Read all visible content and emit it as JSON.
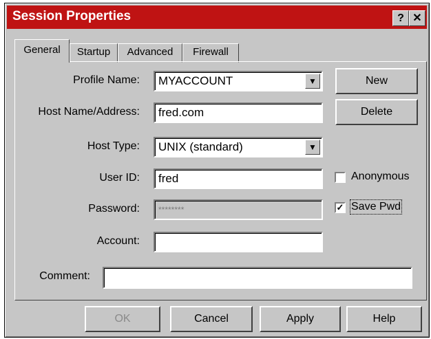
{
  "window": {
    "title": "Session Properties",
    "help_button": "?",
    "close_button": "✕"
  },
  "tabs": [
    {
      "label": "General",
      "active": true
    },
    {
      "label": "Startup",
      "active": false
    },
    {
      "label": "Advanced",
      "active": false
    },
    {
      "label": "Firewall",
      "active": false
    }
  ],
  "form": {
    "profile_name": {
      "label": "Profile Name:",
      "value": "MYACCOUNT"
    },
    "host_name": {
      "label": "Host Name/Address:",
      "value": "fred.com"
    },
    "host_type": {
      "label": "Host Type:",
      "value": "UNIX (standard)"
    },
    "user_id": {
      "label": "User ID:",
      "value": "fred"
    },
    "password": {
      "label": "Password:",
      "value": "********"
    },
    "account": {
      "label": "Account:",
      "value": ""
    },
    "comment": {
      "label": "Comment:",
      "value": ""
    }
  },
  "side_buttons": {
    "new": "New",
    "delete": "Delete"
  },
  "checkboxes": {
    "anonymous": {
      "label": "Anonymous",
      "checked": false,
      "mark": ""
    },
    "save_pwd": {
      "label": "Save Pwd",
      "checked": true,
      "mark": "✓"
    }
  },
  "footer_buttons": {
    "ok": "OK",
    "cancel": "Cancel",
    "apply": "Apply",
    "help": "Help"
  },
  "colors": {
    "titlebar": "#bf1313",
    "face": "#c6c6c6"
  },
  "icons": {
    "dropdown": "▼"
  }
}
